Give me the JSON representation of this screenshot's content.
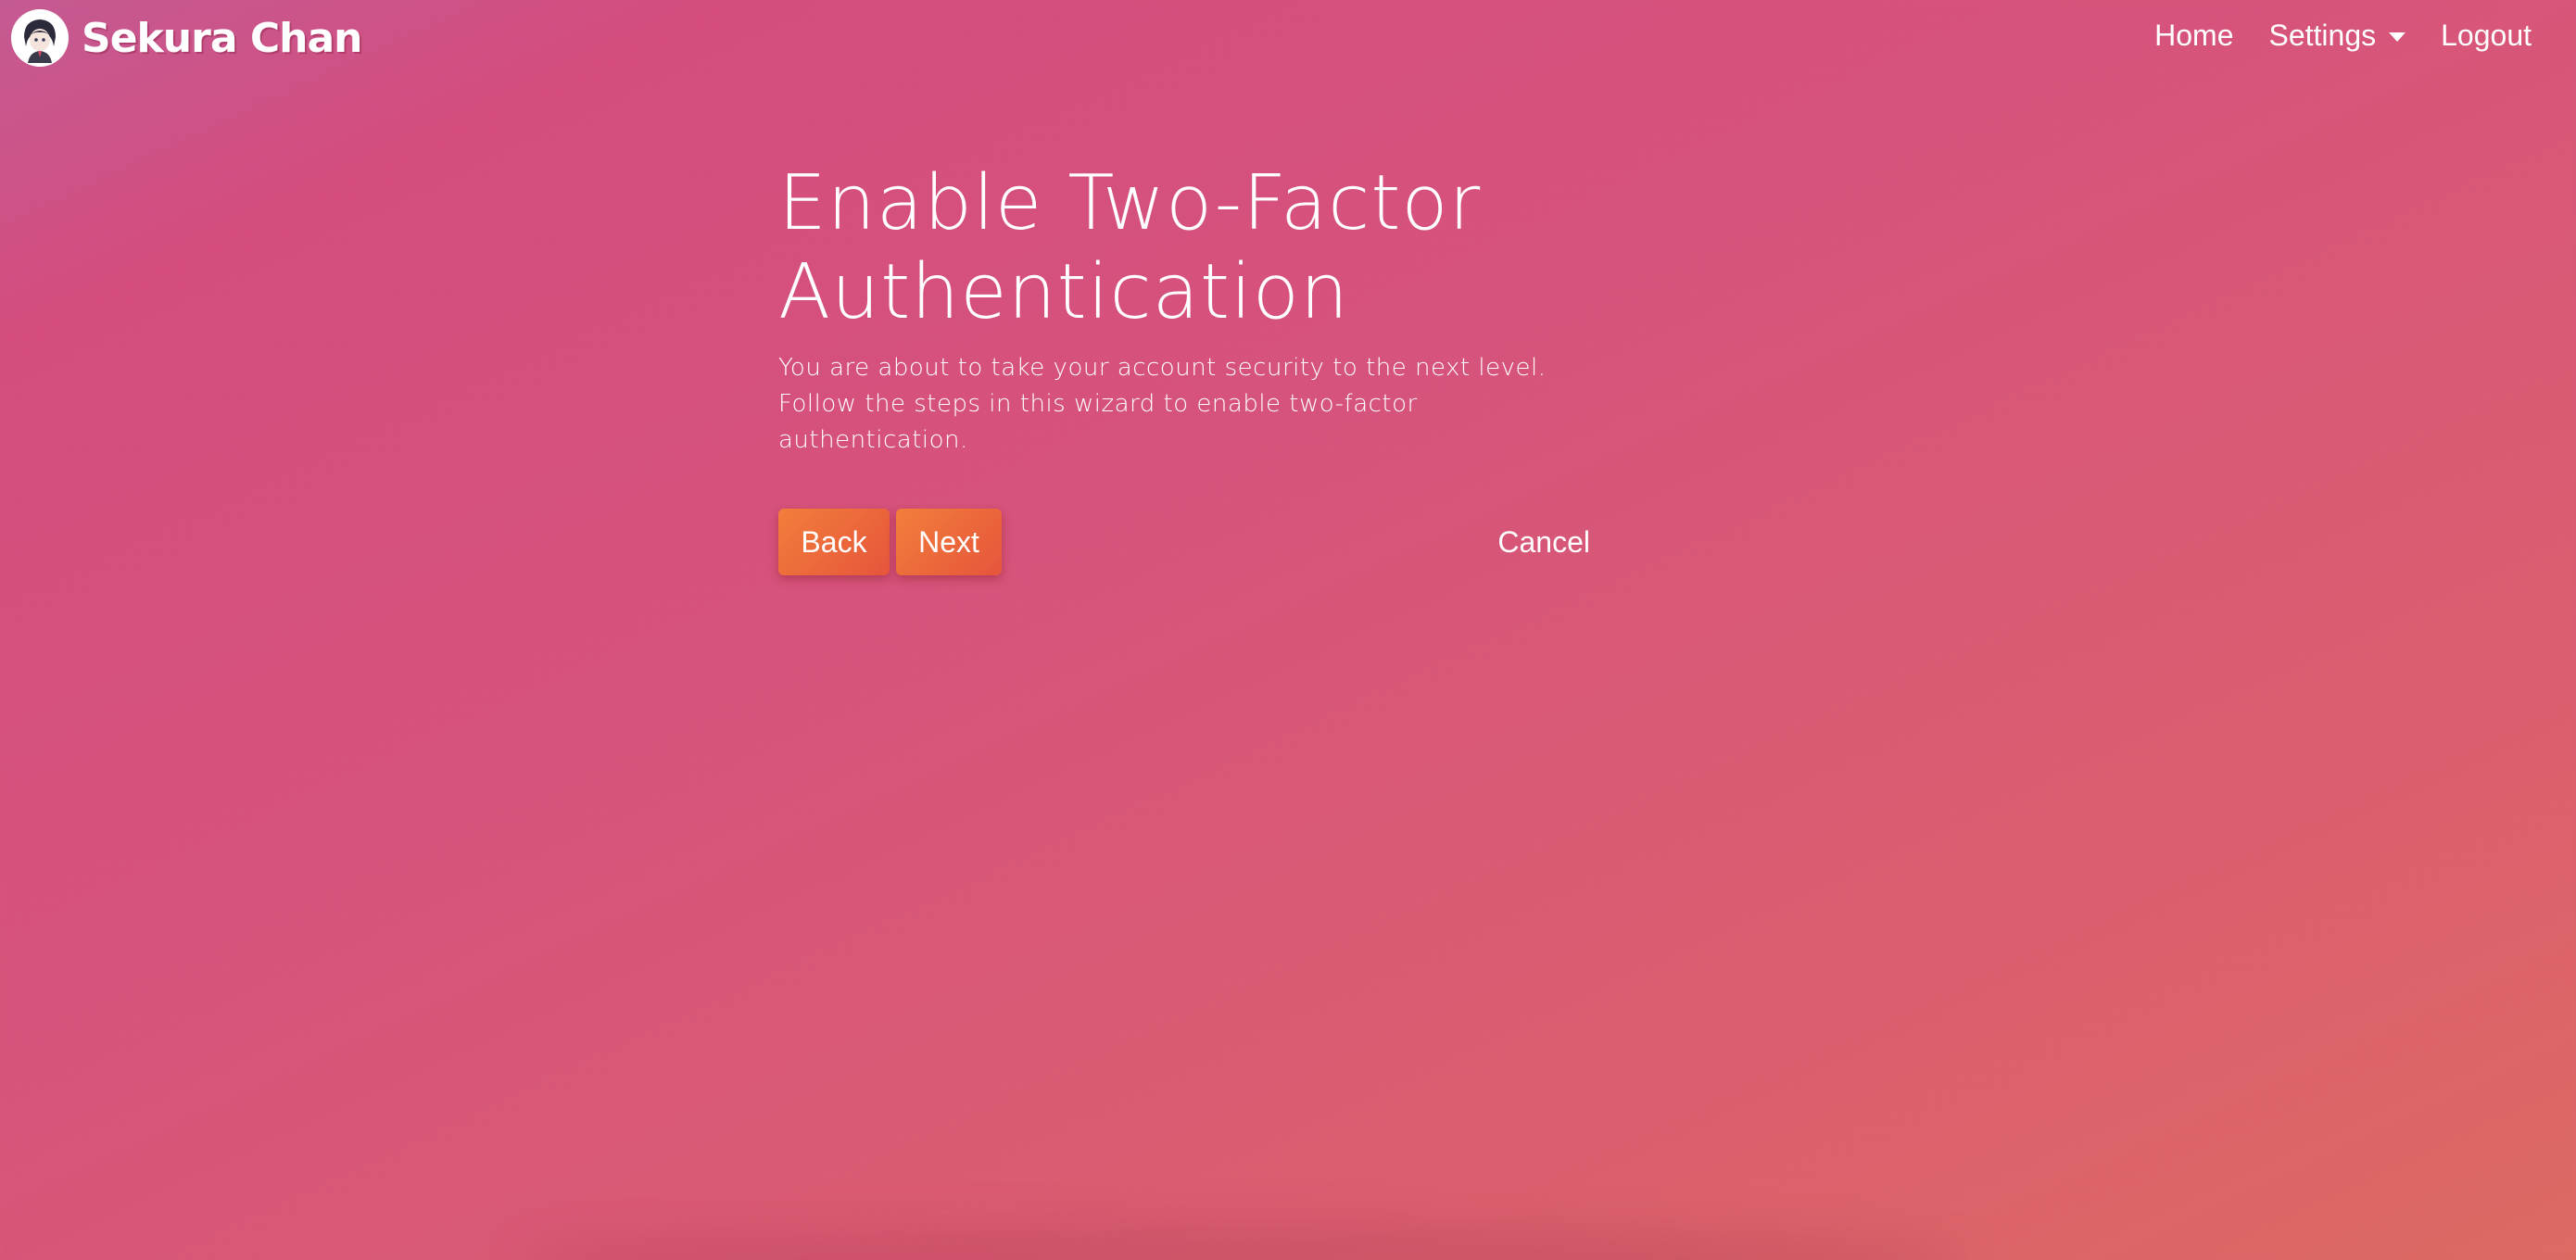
{
  "brand": {
    "name": "Sekura Chan",
    "logo_icon": "anime-avatar-icon"
  },
  "nav": {
    "home": "Home",
    "settings": "Settings",
    "logout": "Logout"
  },
  "main": {
    "title": "Enable Two-Factor Authentication",
    "description": "You are about to take your account security to the next level. Follow the steps in this wizard to enable two-factor authentication.",
    "back_label": "Back",
    "next_label": "Next",
    "cancel_label": "Cancel"
  },
  "colors": {
    "background_start": "#c45a92",
    "background_mid": "#d6537c",
    "background_end": "#dd6a63",
    "button_start": "#f27e3b",
    "button_end": "#e6553b",
    "text": "#ffffff"
  }
}
